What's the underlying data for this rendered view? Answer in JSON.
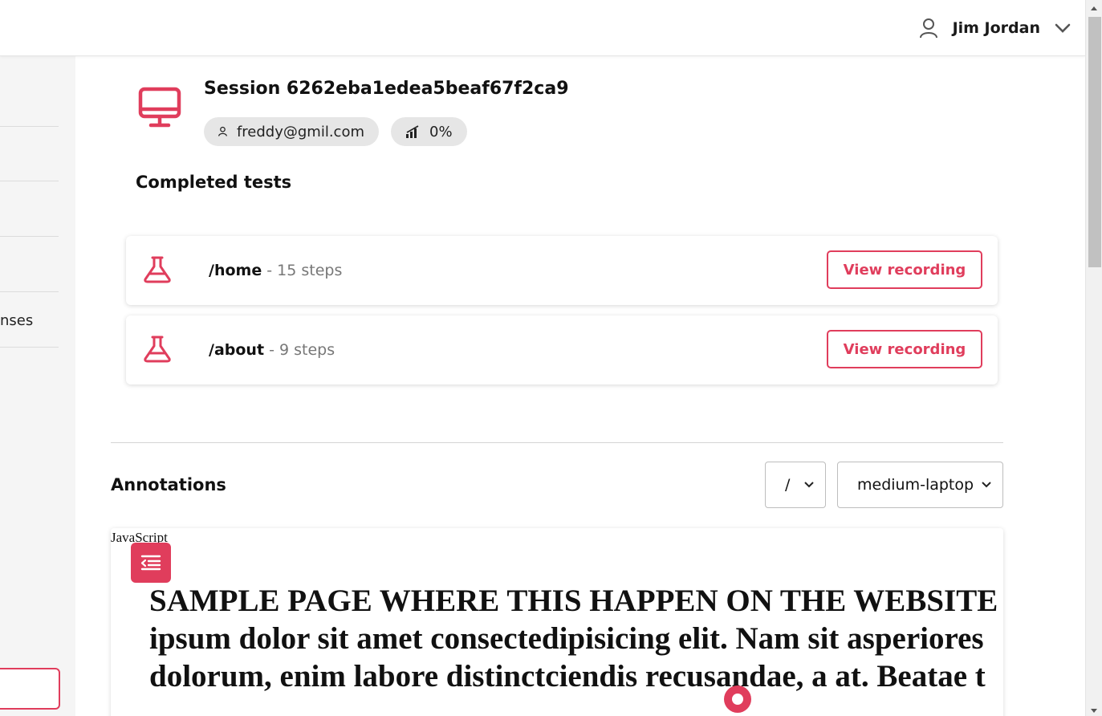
{
  "header": {
    "user_name": "Jim Jordan",
    "user_icon": "user-outline-icon",
    "dropdown_icon": "chevron-down-icon"
  },
  "sidebar": {
    "partial_label": "nses"
  },
  "session": {
    "title": "Session 6262eba1edea5beaf67f2ca9",
    "icon": "desktop-monitor-icon",
    "email": "freddy@gmil.com",
    "progress": "0%"
  },
  "completed_tests": {
    "heading": "Completed tests",
    "items": [
      {
        "route": "/home",
        "separator": " - ",
        "steps": "15 steps",
        "button_label": "View recording"
      },
      {
        "route": "/about",
        "separator": " - ",
        "steps": "9 steps",
        "button_label": "View recording"
      }
    ]
  },
  "annotations": {
    "heading": "Annotations",
    "route_select": "/",
    "device_select": "medium-laptop",
    "overlap_label": "JavaScript",
    "preview_lines": [
      "SAMPLE PAGE WHERE THIS HAPPEN ON THE WEBSITE",
      "ipsum dolor sit amet consectedipisicing elit. Nam sit asperiores",
      "dolorum, enim labore distinctciendis recusandae, a at. Beatae t"
    ]
  },
  "colors": {
    "accent": "#e03d5c",
    "pill_bg": "#e6e6e6",
    "sidebar_bg": "#f5f5f5"
  }
}
